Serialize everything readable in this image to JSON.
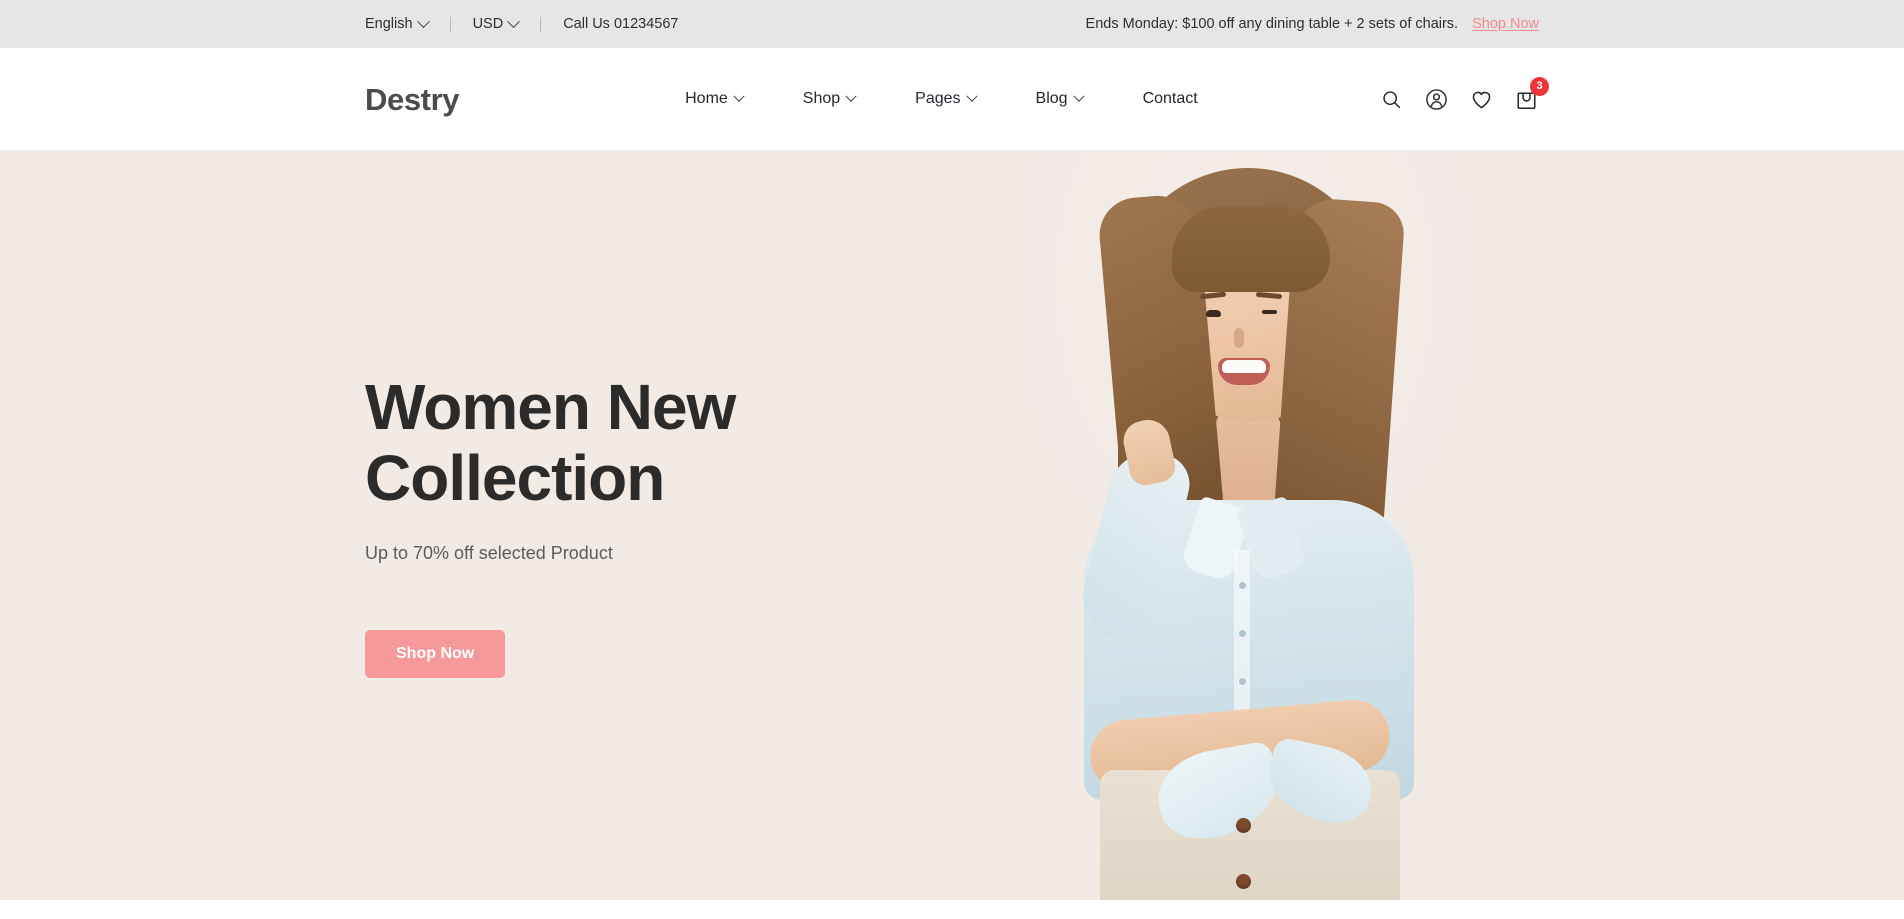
{
  "topbar": {
    "language": "English",
    "currency": "USD",
    "phone": "Call Us 01234567",
    "promo_text": "Ends Monday: $100 off any dining table + 2 sets of chairs.",
    "promo_link": "Shop Now"
  },
  "header": {
    "logo": "Destry",
    "nav": [
      {
        "label": "Home",
        "has_dropdown": true
      },
      {
        "label": "Shop",
        "has_dropdown": true
      },
      {
        "label": "Pages",
        "has_dropdown": true
      },
      {
        "label": "Blog",
        "has_dropdown": true
      },
      {
        "label": "Contact",
        "has_dropdown": false
      }
    ],
    "icons": {
      "search": "search-icon",
      "account": "user-account-icon",
      "wishlist": "heart-icon",
      "cart": "shopping-bag-icon",
      "cart_count": "3"
    }
  },
  "hero": {
    "title": "Women New\nCollection",
    "subtitle": "Up to 70% off selected Product",
    "button": "Shop Now",
    "image_alt": "smiling-woman-in-light-blue-denim-shirt"
  },
  "colors": {
    "topbar_bg": "#e6e6e6",
    "header_bg": "#ffffff",
    "hero_bg": "#f2eae5",
    "accent": "#f5999b",
    "promo_link": "#f58a8a",
    "badge": "#f0353a",
    "heading": "#2b2b2b",
    "text": "#24272e"
  }
}
